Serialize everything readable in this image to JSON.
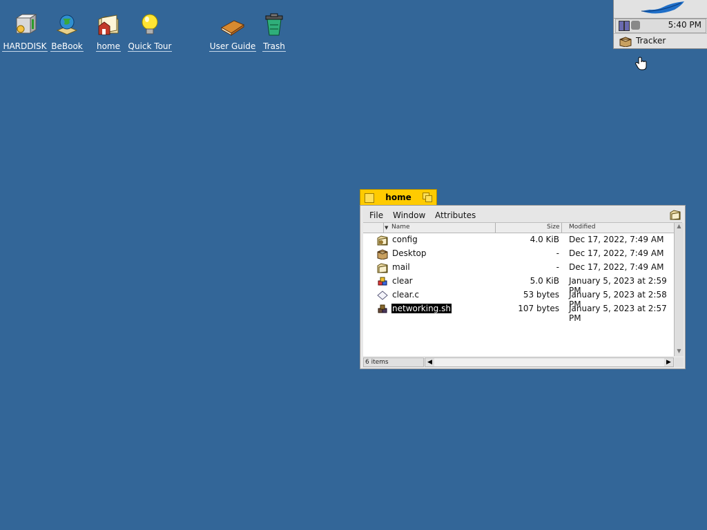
{
  "desktop": {
    "icons": [
      {
        "label": "HARDDISK"
      },
      {
        "label": "BeBook"
      },
      {
        "label": "home"
      },
      {
        "label": "Quick Tour"
      },
      {
        "label": "User Guide"
      },
      {
        "label": "Trash"
      }
    ]
  },
  "deskbar": {
    "clock": "5:40 PM",
    "tracker_label": "Tracker"
  },
  "window": {
    "title": "home",
    "menu": [
      "File",
      "Window",
      "Attributes"
    ],
    "columns": {
      "name": "Name",
      "size": "Size",
      "modified": "Modified"
    },
    "rows": [
      {
        "name": "config",
        "size": "4.0 KiB",
        "modified": "Dec 17, 2022, 7:49 AM",
        "icon": "folder-config-icon"
      },
      {
        "name": "Desktop",
        "size": "-",
        "modified": "Dec 17, 2022, 7:49 AM",
        "icon": "desktop-folder-icon"
      },
      {
        "name": "mail",
        "size": "-",
        "modified": "Dec 17, 2022, 7:49 AM",
        "icon": "folder-mail-icon"
      },
      {
        "name": "clear",
        "size": "5.0 KiB",
        "modified": "January 5, 2023 at 2:59 PM",
        "icon": "executable-icon"
      },
      {
        "name": "clear.c",
        "size": "53 bytes",
        "modified": "January 5, 2023 at 2:58 PM",
        "icon": "source-file-icon"
      },
      {
        "name": "networking.sh",
        "size": "107 bytes",
        "modified": "January 5, 2023 at 2:57 PM",
        "icon": "script-icon"
      }
    ],
    "status": "6 items"
  },
  "colors": {
    "desktop": "#336698",
    "window_tab": "#ffcb00"
  }
}
